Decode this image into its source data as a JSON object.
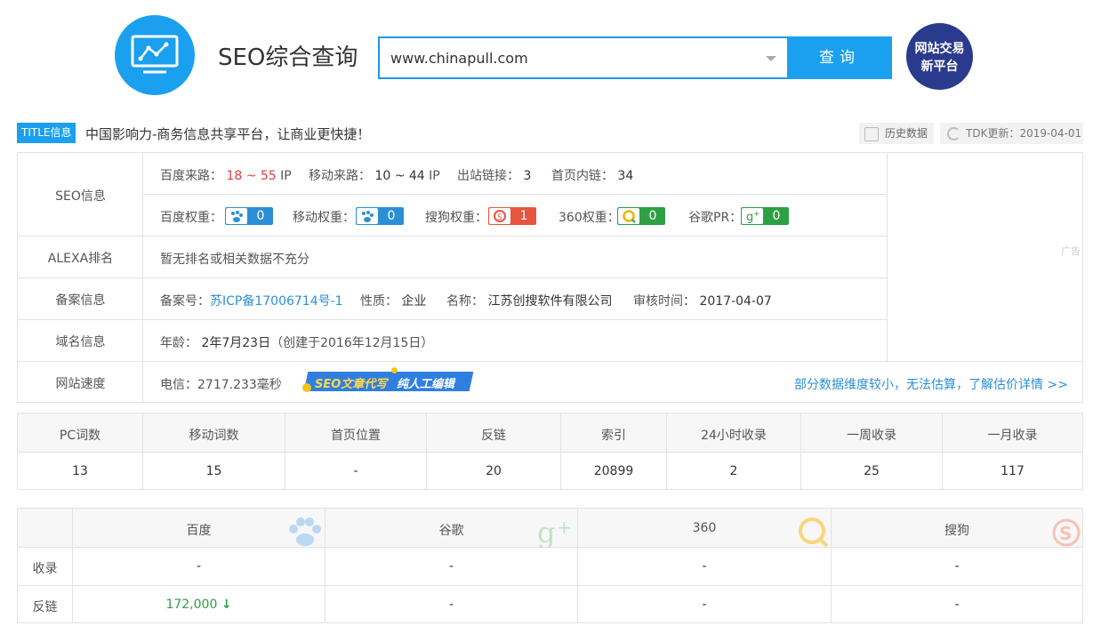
{
  "header": {
    "site_title": "SEO综合查询",
    "search_value": "www.chinapull.com",
    "search_button": "查询",
    "badge_line1": "网站交易",
    "badge_line2": "新平台"
  },
  "title_row": {
    "tag": "TITLE信息",
    "text": "中国影响力-商务信息共享平台，让商业更快捷！",
    "history_button": "历史数据",
    "tdk_update": "TDK更新：2019-04-01"
  },
  "seo_info": {
    "label": "SEO信息",
    "baidu_traffic_label": "百度来路：",
    "baidu_traffic_value": "18 ~ 55",
    "baidu_traffic_unit": "IP",
    "mobile_traffic_label": "移动来路：",
    "mobile_traffic_value": "10 ~ 44",
    "mobile_traffic_unit": "IP",
    "outbound_label": "出站链接：",
    "outbound_value": "3",
    "homepage_links_label": "首页内链：",
    "homepage_links_value": "34",
    "weights": [
      {
        "label": "百度权重：",
        "value": "0",
        "color": "#2c8fd6"
      },
      {
        "label": "移动权重：",
        "value": "0",
        "color": "#2c8fd6"
      },
      {
        "label": "搜狗权重：",
        "value": "1",
        "color": "#e8553f"
      },
      {
        "label": "360权重：",
        "value": "0",
        "color": "#2ea043"
      },
      {
        "label": "谷歌PR：",
        "value": "0",
        "color": "#2ea043"
      }
    ]
  },
  "alexa": {
    "label": "ALEXA排名",
    "value": "暂无排名或相关数据不充分"
  },
  "icp": {
    "label": "备案信息",
    "number_label": "备案号：",
    "number_value": "苏ICP备17006714号-1",
    "nature_label": "性质：",
    "nature_value": "企业",
    "name_label": "名称：",
    "name_value": "江苏创搜软件有限公司",
    "audit_label": "审核时间：",
    "audit_value": "2017-04-07"
  },
  "domain": {
    "label": "域名信息",
    "age_label": "年龄：",
    "age_value": "2年7月23日",
    "created": "（创建于2016年12月15日）"
  },
  "speed": {
    "label": "网站速度",
    "value": "电信：2717.233毫秒",
    "promo_a": "SEO文章代写",
    "promo_b": "纯人工编辑",
    "estimate_link": "部分数据维度较小，无法估算，了解估价详情 >>"
  },
  "ad_label": "广告",
  "stats": {
    "headers": [
      "PC词数",
      "移动词数",
      "首页位置",
      "反链",
      "索引",
      "24小时收录",
      "一周收录",
      "一月收录"
    ],
    "values": [
      "13",
      "15",
      "-",
      "20",
      "20899",
      "2",
      "25",
      "117"
    ]
  },
  "engines": {
    "headers": [
      "百度",
      "谷歌",
      "360",
      "搜狗"
    ],
    "rows": [
      {
        "label": "收录",
        "values": [
          "-",
          "-",
          "-",
          "-"
        ]
      },
      {
        "label": "反链",
        "values": [
          "172,000",
          "-",
          "-",
          "-"
        ]
      }
    ]
  }
}
